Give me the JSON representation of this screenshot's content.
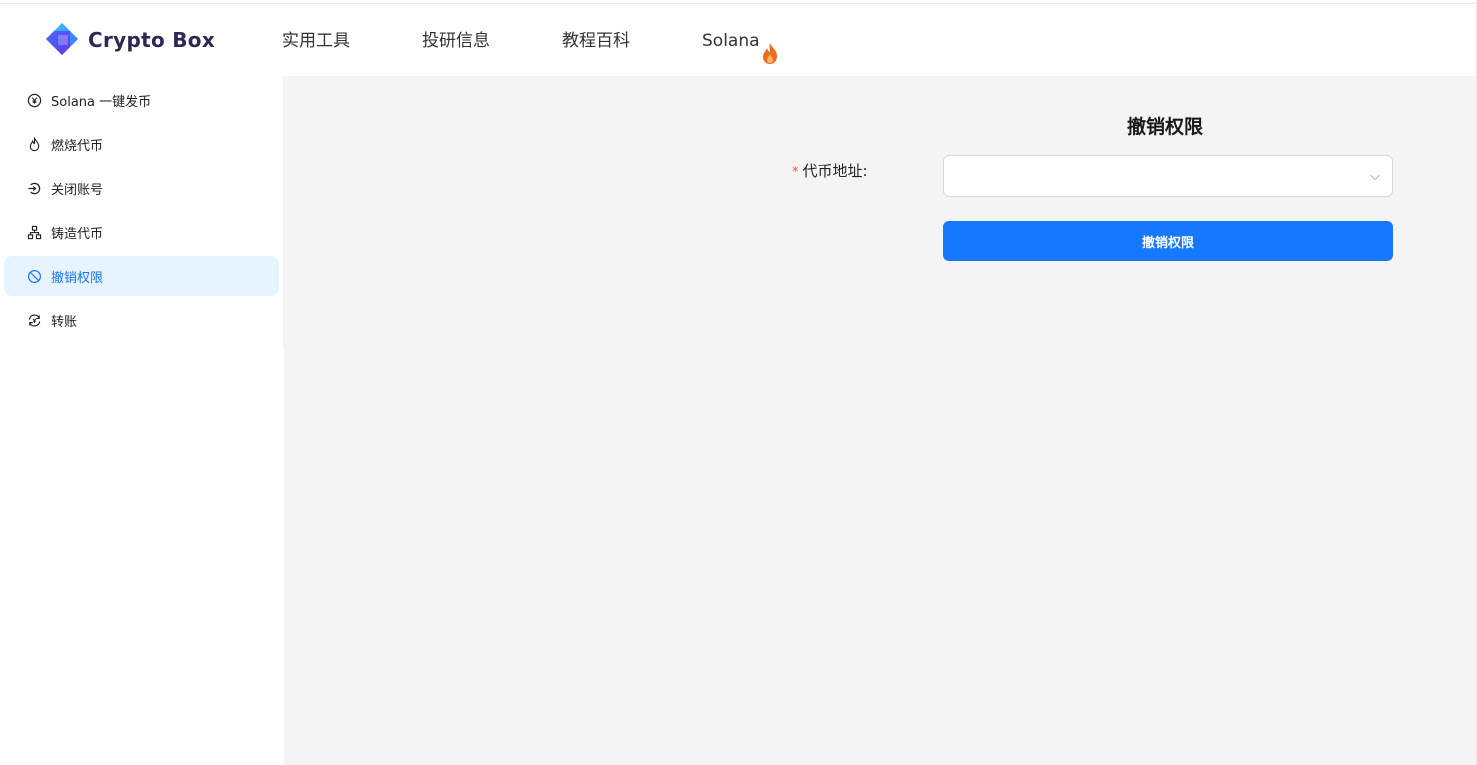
{
  "brand": {
    "name": "Crypto Box",
    "logo_icon": "crypto-box-logo-icon"
  },
  "nav": {
    "items": [
      {
        "label": "实用工具"
      },
      {
        "label": "投研信息"
      },
      {
        "label": "教程百科"
      },
      {
        "label": "Solana",
        "icon": "fire-icon"
      }
    ]
  },
  "sidebar": {
    "items": [
      {
        "label": "Solana 一键发币",
        "icon": "coin-circle-icon",
        "active": false
      },
      {
        "label": "燃烧代币",
        "icon": "flame-icon",
        "active": false
      },
      {
        "label": "关闭账号",
        "icon": "logout-icon",
        "active": false
      },
      {
        "label": "铸造代币",
        "icon": "cluster-icon",
        "active": false
      },
      {
        "label": "撤销权限",
        "icon": "stop-icon",
        "active": true
      },
      {
        "label": "转账",
        "icon": "transfer-icon",
        "active": false
      }
    ]
  },
  "form": {
    "title": "撤销权限",
    "required_mark": "*",
    "token_address_label": "代币地址:",
    "token_address_value": "",
    "submit_label": "撤销权限"
  },
  "colors": {
    "accent": "#1677ff",
    "active_bg": "#e6f4ff",
    "main_bg": "#f4f4f4",
    "required": "#ff4d4f",
    "fire": "#f26b1d"
  }
}
